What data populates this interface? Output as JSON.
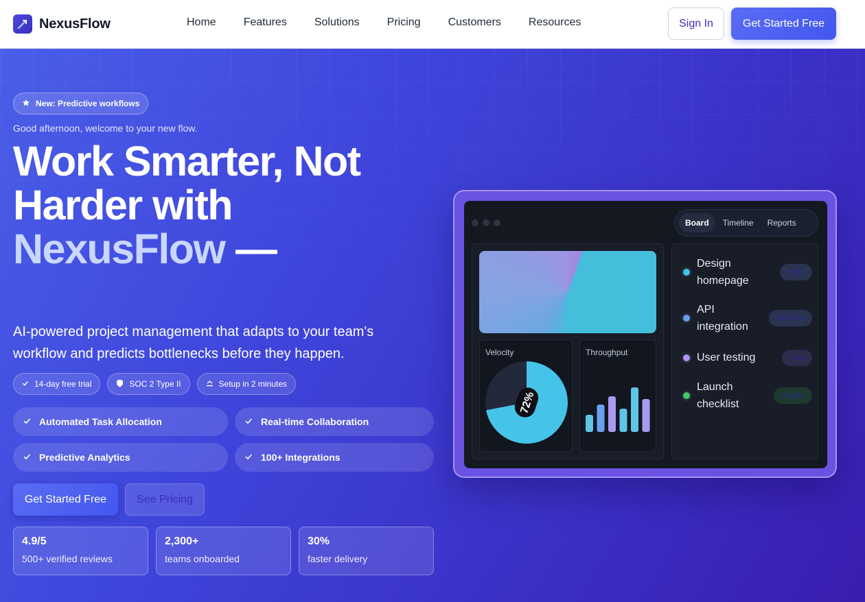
{
  "brand": {
    "name": "NexusFlow"
  },
  "nav": {
    "items": [
      "Home",
      "Features",
      "Solutions",
      "Pricing",
      "Customers",
      "Resources"
    ]
  },
  "header": {
    "signin_label": "Sign In",
    "cta_label": "Get Started Free"
  },
  "hero": {
    "badge": "New: Predictive workflows",
    "greeting": "Good afternoon, welcome to your new flow.",
    "headline_line1": "Work Smarter, Not",
    "headline_line2": "Harder with",
    "headline_accent": "NexusFlow",
    "headline_suffix": "—",
    "subtitle": "AI-powered project management that adapts to your team's workflow and predicts bottlenecks before they happen.",
    "pills": [
      {
        "icon": "check-icon",
        "label": "14-day free trial"
      },
      {
        "icon": "shield-icon",
        "label": "SOC 2 Type II"
      },
      {
        "icon": "upload-icon",
        "label": "Setup in 2 minutes"
      }
    ],
    "features": [
      "Automated Task Allocation",
      "Real-time Collaboration",
      "Predictive Analytics",
      "100+ Integrations"
    ],
    "cta_primary": "Get Started Free",
    "cta_secondary": "See Pricing",
    "stats": [
      {
        "value": "4.9/5",
        "label": "500+ verified reviews"
      },
      {
        "value": "2,300+",
        "label": "teams onboarded"
      },
      {
        "value": "30%",
        "label": "faster delivery"
      }
    ]
  },
  "dashboard": {
    "tabs": [
      "Board",
      "Timeline",
      "Reports"
    ],
    "active_tab": "Board",
    "velocity": {
      "title": "Velocity",
      "value_label": "72%",
      "fraction": 0.72
    },
    "throughput": {
      "title": "Throughput",
      "bars": [
        0.25,
        0.4,
        0.52,
        0.34,
        0.65,
        0.48
      ]
    },
    "tasks": [
      {
        "name": "Design homepage",
        "tag": "High",
        "dot": "#3fc6e6",
        "tag_color": "#2a3350"
      },
      {
        "name": "API integration",
        "tag": "Medium",
        "dot": "#6c9cf0",
        "tag_color": "#2a3350"
      },
      {
        "name": "User testing",
        "tag": "Low",
        "dot": "#b193f0",
        "tag_color": "#2f2b4d"
      },
      {
        "name": "Launch checklist",
        "tag": "Ready",
        "dot": "#44c76a",
        "tag_color": "#1e3a2e"
      }
    ]
  },
  "colors": {
    "accent": "#4257ee",
    "brand_dark": "#3b2fb8",
    "hero_start": "#4a5ee8",
    "hero_end": "#3a1db0",
    "velocity_fill": "#45c3e8",
    "bar_blue": "#5fc4e6",
    "bar_purple": "#a99af0"
  }
}
